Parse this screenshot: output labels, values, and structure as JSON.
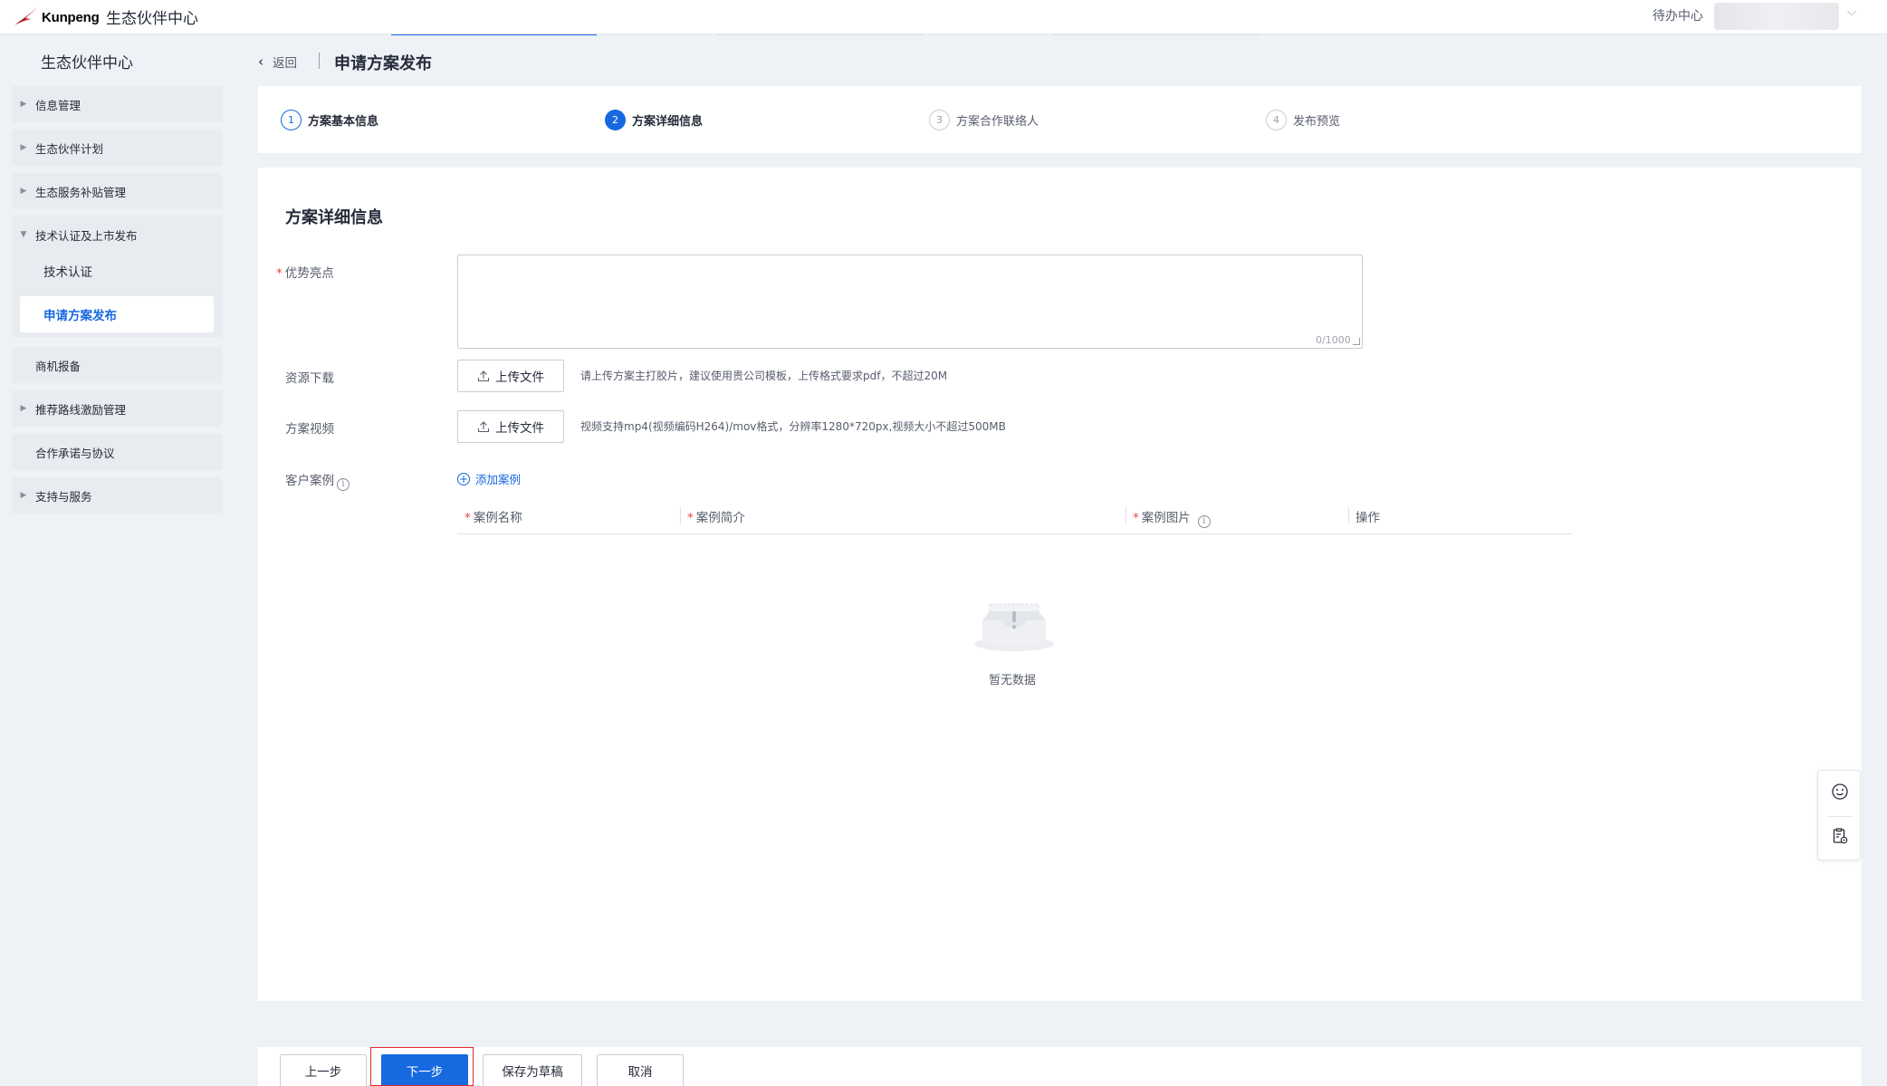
{
  "topbar": {
    "logo_text": "Kunpeng",
    "title": "生态伙伴中心",
    "todo": "待办中心"
  },
  "sidebar": {
    "title": "生态伙伴中心",
    "items": [
      {
        "label": "信息管理",
        "expandable": true
      },
      {
        "label": "生态伙伴计划",
        "expandable": true
      },
      {
        "label": "生态服务补贴管理",
        "expandable": true
      },
      {
        "label": "技术认证及上市发布",
        "expandable": true,
        "expanded": true,
        "children": [
          {
            "label": "技术认证"
          },
          {
            "label": "申请方案发布",
            "active": true
          }
        ]
      },
      {
        "label": "商机报备",
        "expandable": false
      },
      {
        "label": "推荐路线激励管理",
        "expandable": true
      },
      {
        "label": "合作承诺与协议",
        "expandable": false
      },
      {
        "label": "支持与服务",
        "expandable": true
      }
    ]
  },
  "header": {
    "back_label": "返回",
    "page_title": "申请方案发布"
  },
  "steps": [
    {
      "num": "1",
      "label": "方案基本信息",
      "state": "done"
    },
    {
      "num": "2",
      "label": "方案详细信息",
      "state": "current"
    },
    {
      "num": "3",
      "label": "方案合作联络人",
      "state": "pending"
    },
    {
      "num": "4",
      "label": "发布预览",
      "state": "pending"
    }
  ],
  "form": {
    "section_title": "方案详细信息",
    "advantage": {
      "label": "优势亮点",
      "required": true,
      "value": "",
      "counter": "0/1000"
    },
    "resource": {
      "label": "资源下载",
      "button": "上传文件",
      "hint": "请上传方案主打胶片，建议使用贵公司模板，上传格式要求pdf，不超过20M"
    },
    "video": {
      "label": "方案视频",
      "button": "上传文件",
      "hint": "视频支持mp4(视频编码H264)/mov格式，分辨率1280*720px,视频大小不超过500MB"
    },
    "cases": {
      "label": "客户案例",
      "add_label": "添加案例",
      "columns": [
        {
          "label": "案例名称",
          "required": true
        },
        {
          "label": "案例简介",
          "required": true
        },
        {
          "label": "案例图片",
          "required": true,
          "info": true
        },
        {
          "label": "操作",
          "required": false
        }
      ],
      "empty_text": "暂无数据"
    }
  },
  "footer": {
    "prev": "上一步",
    "next": "下一步",
    "save_draft": "保存为草稿",
    "cancel": "取消"
  },
  "colors": {
    "primary": "#1769e0",
    "required": "#e54545",
    "highlight_box": "#e0292c",
    "background": "#eef1f6"
  }
}
